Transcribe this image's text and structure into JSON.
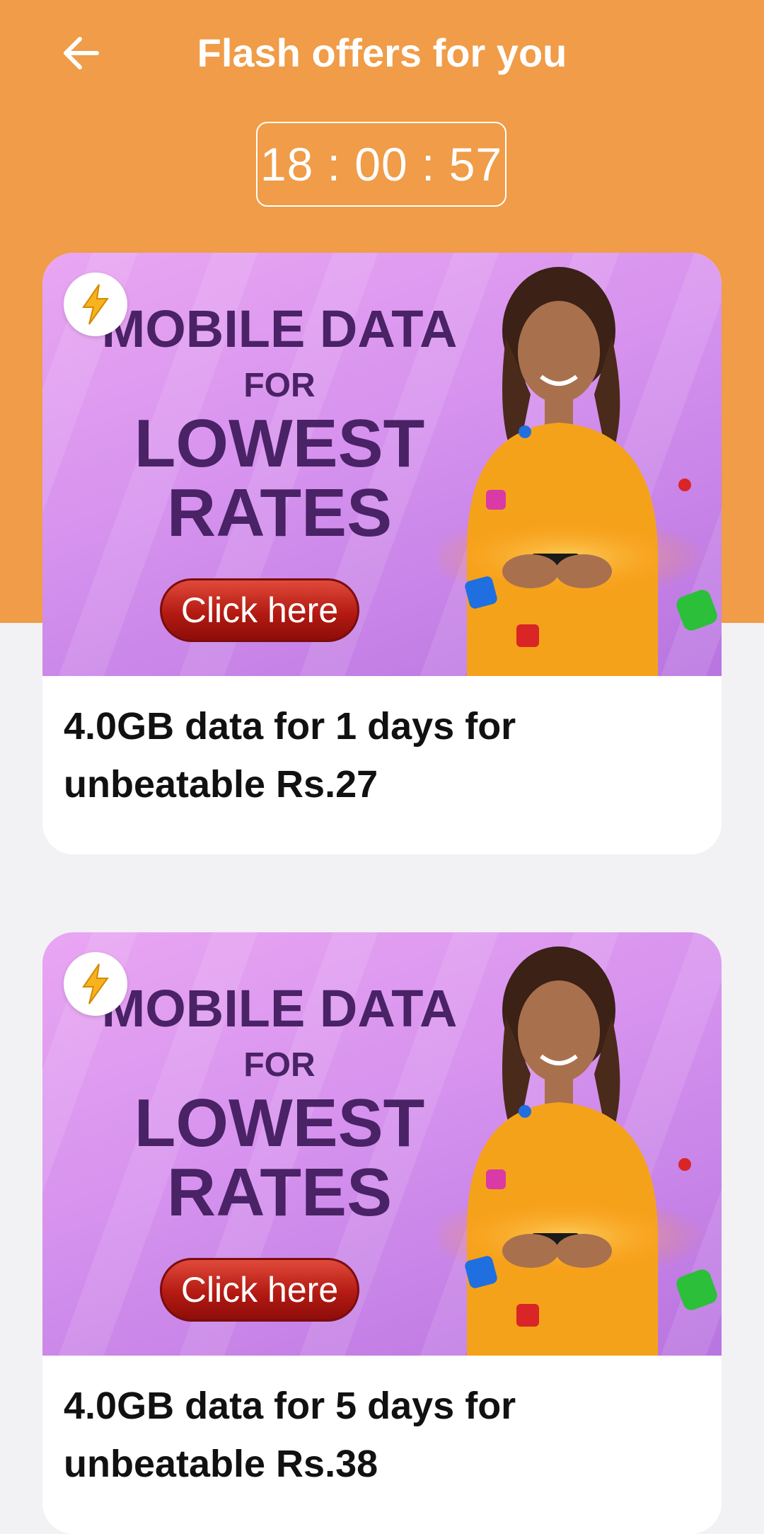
{
  "header": {
    "back_icon": "arrow-left-icon",
    "title": "Flash offers for you"
  },
  "timer": {
    "hours": "18",
    "minutes": "00",
    "seconds": "57",
    "display": "18 : 00 : 57"
  },
  "offers": [
    {
      "banner": {
        "line1": "MOBILE DATA",
        "line2": "FOR",
        "line3": "LOWEST",
        "line4": "RATES",
        "cta": "Click here"
      },
      "text_line1": "4.0GB data for 1 days for",
      "text_line2": "unbeatable Rs.27"
    },
    {
      "banner": {
        "line1": "MOBILE DATA",
        "line2": "FOR",
        "line3": "LOWEST",
        "line4": "RATES",
        "cta": "Click here"
      },
      "text_line1": "4.0GB data for 5 days for",
      "text_line2": "unbeatable Rs.38"
    }
  ],
  "colors": {
    "header_bg": "#f09c48",
    "page_bg": "#f2f2f5",
    "banner_text": "#4a2266",
    "cta_red": "#b41a12"
  }
}
